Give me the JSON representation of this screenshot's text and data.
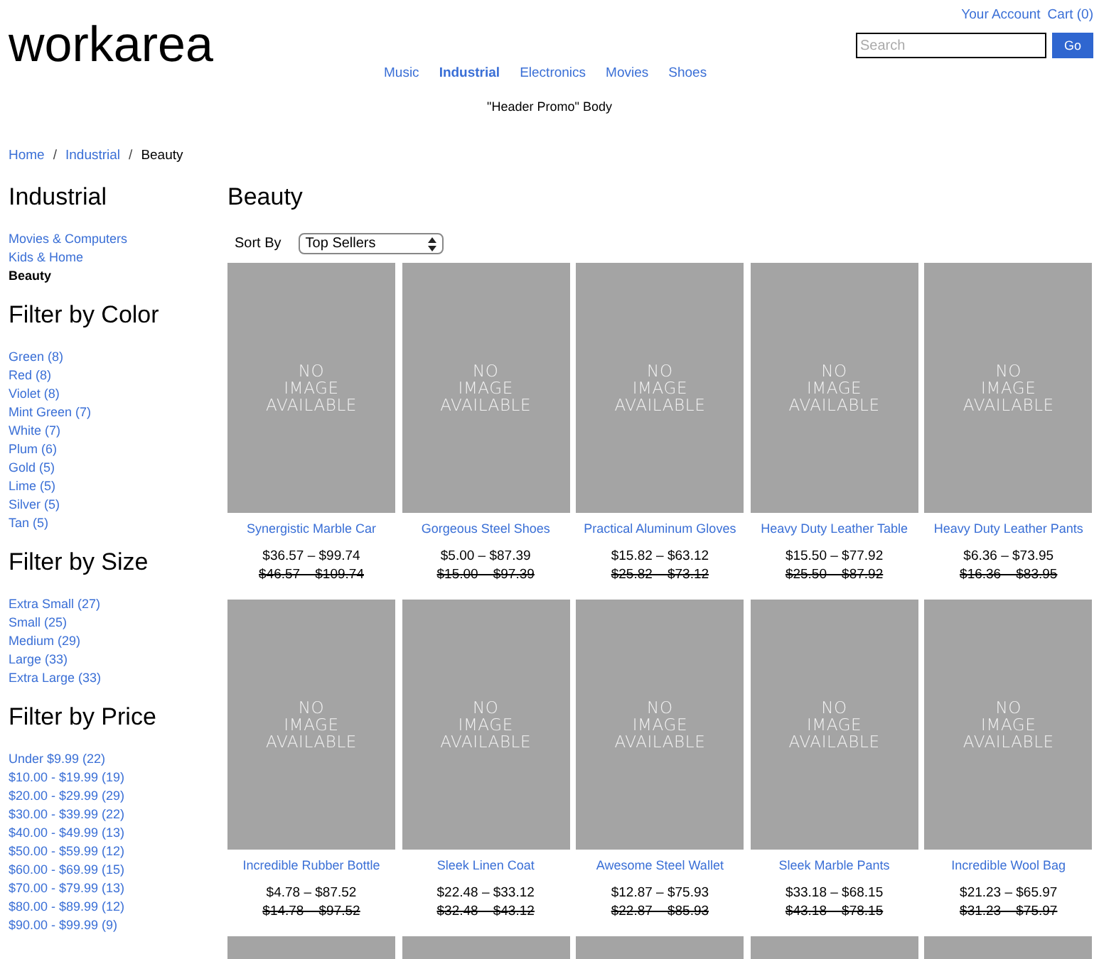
{
  "logo": "workarea",
  "account_links": [
    "Your Account",
    "Cart (0)"
  ],
  "search": {
    "placeholder": "Search",
    "button": "Go"
  },
  "nav": [
    {
      "label": "Music",
      "selected": false
    },
    {
      "label": "Industrial",
      "selected": true
    },
    {
      "label": "Electronics",
      "selected": false
    },
    {
      "label": "Movies",
      "selected": false
    },
    {
      "label": "Shoes",
      "selected": false
    }
  ],
  "promo": "\"Header Promo\" Body",
  "breadcrumb_separator": "/",
  "breadcrumb": [
    {
      "label": "Home",
      "current": false
    },
    {
      "label": "Industrial",
      "current": false
    },
    {
      "label": "Beauty",
      "current": true
    }
  ],
  "sidebar": {
    "title": "Industrial",
    "categories": [
      {
        "label": "Movies & Computers",
        "selected": false
      },
      {
        "label": "Kids & Home",
        "selected": false
      },
      {
        "label": "Beauty",
        "selected": true
      }
    ],
    "filters": [
      {
        "title": "Filter by Color",
        "options": [
          "Green (8)",
          "Red (8)",
          "Violet (8)",
          "Mint Green (7)",
          "White (7)",
          "Plum (6)",
          "Gold (5)",
          "Lime (5)",
          "Silver (5)",
          "Tan (5)"
        ]
      },
      {
        "title": "Filter by Size",
        "options": [
          "Extra Small (27)",
          "Small (25)",
          "Medium (29)",
          "Large (33)",
          "Extra Large (33)"
        ]
      },
      {
        "title": "Filter by Price",
        "options": [
          "Under $9.99 (22)",
          "$10.00 - $19.99 (19)",
          "$20.00 - $29.99 (29)",
          "$30.00 - $39.99 (22)",
          "$40.00 - $49.99 (13)",
          "$50.00 - $59.99 (12)",
          "$60.00 - $69.99 (15)",
          "$70.00 - $79.99 (13)",
          "$80.00 - $89.99 (12)",
          "$90.00 - $99.99 (9)"
        ]
      }
    ]
  },
  "page_title": "Beauty",
  "sort": {
    "label": "Sort By",
    "value": "Top Sellers"
  },
  "products": [
    {
      "kind": "full",
      "image_text": "NO IMAGE AVAILABLE",
      "name": "Synergistic Marble Car",
      "price": "$36.57 – $99.74",
      "original_price": "$46.57 – $109.74"
    },
    {
      "kind": "full",
      "image_text": "NO IMAGE AVAILABLE",
      "name": "Gorgeous Steel Shoes",
      "price": "$5.00 – $87.39",
      "original_price": "$15.00 – $97.39"
    },
    {
      "kind": "full",
      "image_text": "NO IMAGE AVAILABLE",
      "name": "Practical Aluminum Gloves",
      "price": "$15.82 – $63.12",
      "original_price": "$25.82 – $73.12"
    },
    {
      "kind": "full",
      "image_text": "NO IMAGE AVAILABLE",
      "name": "Heavy Duty Leather Table",
      "price": "$15.50 – $77.92",
      "original_price": "$25.50 – $87.92"
    },
    {
      "kind": "full",
      "image_text": "NO IMAGE AVAILABLE",
      "name": "Heavy Duty Leather Pants",
      "price": "$6.36 – $73.95",
      "original_price": "$16.36 – $83.95"
    },
    {
      "kind": "full",
      "image_text": "NO IMAGE AVAILABLE",
      "name": "Incredible Rubber Bottle",
      "price": "$4.78 – $87.52",
      "original_price": "$14.78 – $97.52"
    },
    {
      "kind": "full",
      "image_text": "NO IMAGE AVAILABLE",
      "name": "Sleek Linen Coat",
      "price": "$22.48 – $33.12",
      "original_price": "$32.48 – $43.12"
    },
    {
      "kind": "full",
      "image_text": "NO IMAGE AVAILABLE",
      "name": "Awesome Steel Wallet",
      "price": "$12.87 – $75.93",
      "original_price": "$22.87 – $85.93"
    },
    {
      "kind": "full",
      "image_text": "NO IMAGE AVAILABLE",
      "name": "Sleek Marble Pants",
      "price": "$33.18 – $68.15",
      "original_price": "$43.18 – $78.15"
    },
    {
      "kind": "full",
      "image_text": "NO IMAGE AVAILABLE",
      "name": "Incredible Wool Bag",
      "price": "$21.23 – $65.97",
      "original_price": "$31.23 – $75.97"
    },
    {
      "kind": "cut"
    },
    {
      "kind": "cut"
    },
    {
      "kind": "cut"
    },
    {
      "kind": "cut"
    },
    {
      "kind": "cut"
    }
  ]
}
